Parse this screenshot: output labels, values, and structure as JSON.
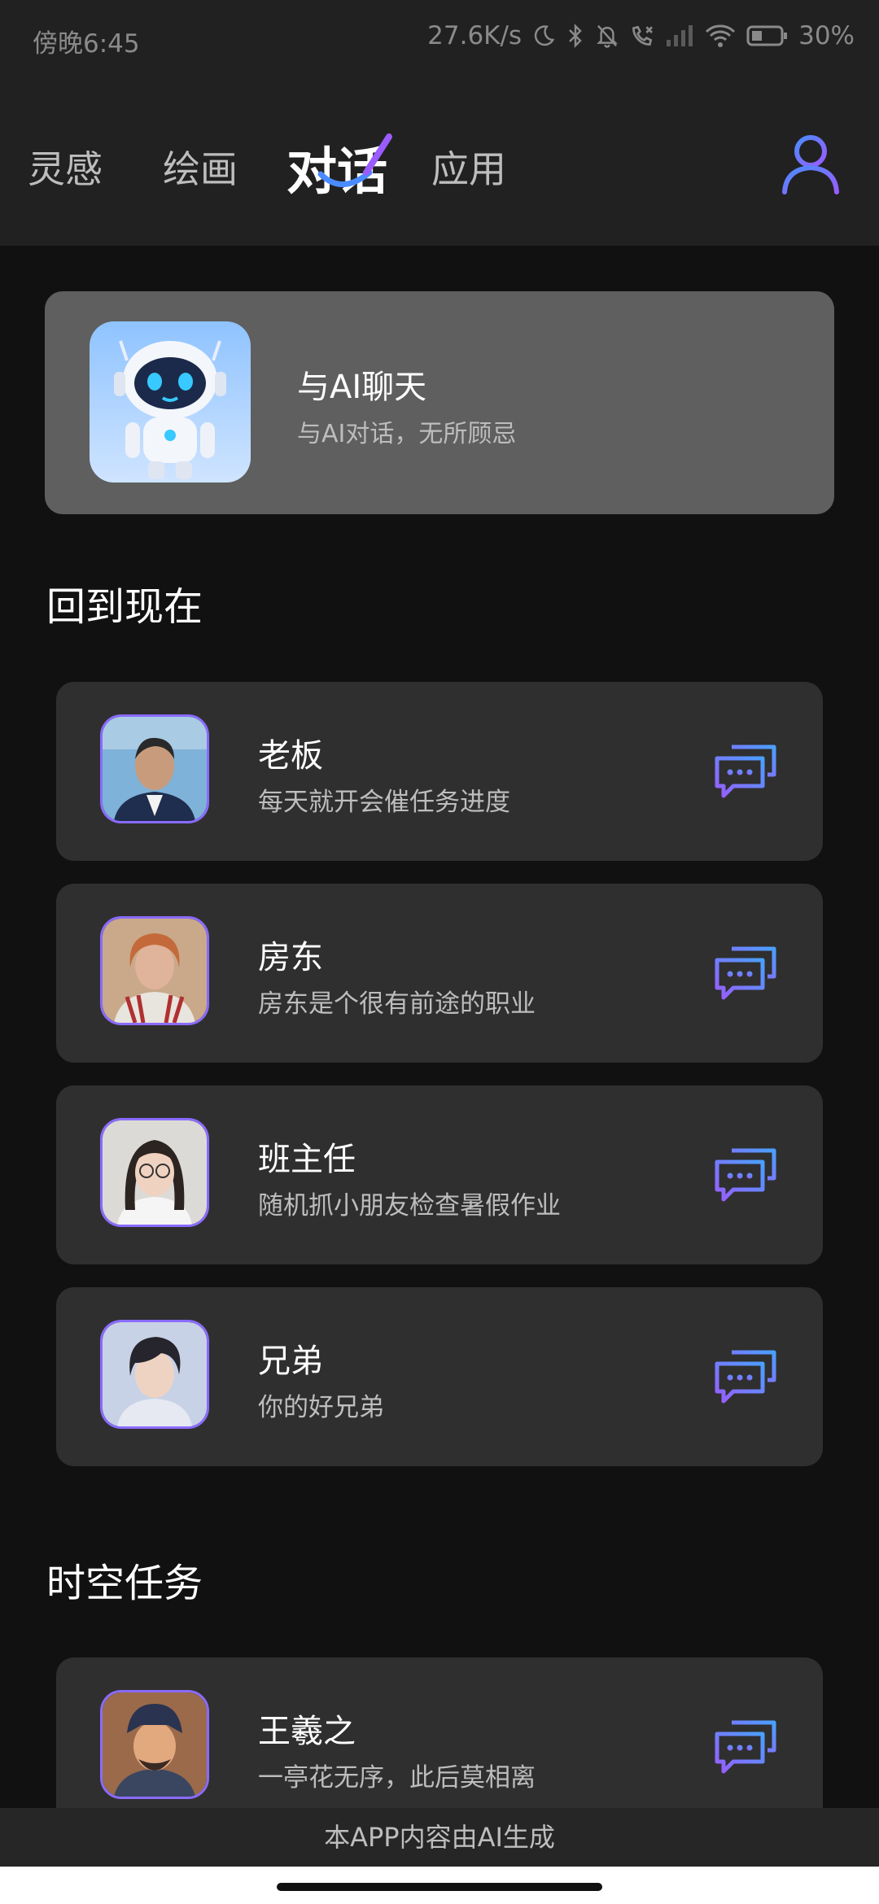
{
  "status_bar": {
    "time": "傍晚6:45",
    "network_speed": "27.6K/s",
    "battery": "30%",
    "icons": [
      "moon-icon",
      "bluetooth-icon",
      "bell-off-icon",
      "call-blocked-icon",
      "signal-icon",
      "wifi-icon",
      "battery-icon"
    ]
  },
  "nav": {
    "tabs": [
      {
        "label": "灵感",
        "active": false
      },
      {
        "label": "绘画",
        "active": false
      },
      {
        "label": "对话",
        "active": true
      },
      {
        "label": "应用",
        "active": false
      }
    ],
    "profile_icon": "user-icon"
  },
  "ai_card": {
    "title": "与AI聊天",
    "subtitle": "与AI对话，无所顾忌",
    "avatar_icon": "robot-icon"
  },
  "sections": [
    {
      "title": "回到现在",
      "items": [
        {
          "name": "老板",
          "desc": "每天就开会催任务进度"
        },
        {
          "name": "房东",
          "desc": "房东是个很有前途的职业"
        },
        {
          "name": "班主任",
          "desc": "随机抓小朋友检查暑假作业"
        },
        {
          "name": "兄弟",
          "desc": "你的好兄弟"
        }
      ]
    },
    {
      "title": "时空任务",
      "items": [
        {
          "name": "王羲之",
          "desc": "一亭花无序，此后莫相离"
        }
      ]
    }
  ],
  "footer": {
    "text": "本APP内容由AI生成"
  },
  "colors": {
    "accent_blue": "#4a8cff",
    "accent_purple": "#9a5cff",
    "card_bg": "#2f2f2f",
    "ai_card_bg": "#5f5f5f"
  }
}
